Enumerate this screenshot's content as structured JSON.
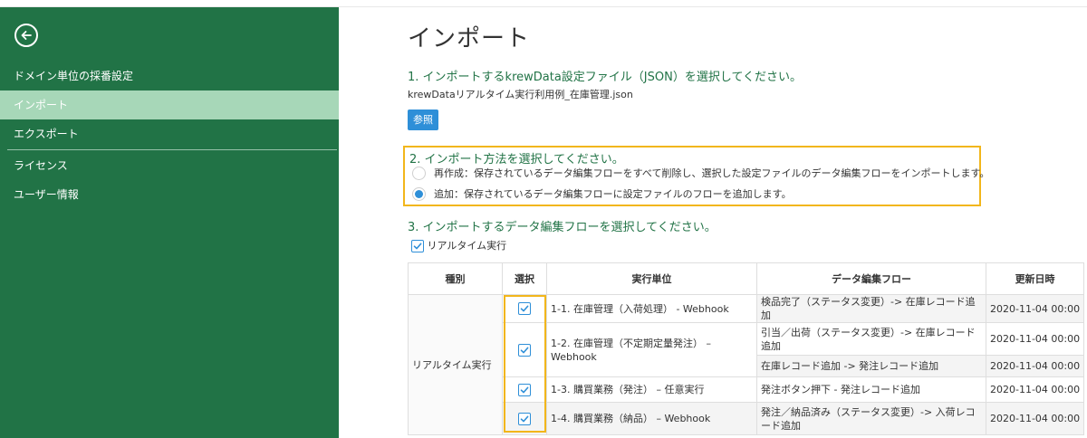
{
  "sidebar": {
    "items": [
      {
        "label": "ドメイン単位の採番設定"
      },
      {
        "label": "インポート"
      },
      {
        "label": "エクスポート"
      },
      {
        "label": "ライセンス"
      },
      {
        "label": "ユーザー情報"
      }
    ]
  },
  "main": {
    "title": "インポート",
    "step1": {
      "title": "1. インポートするkrewData設定ファイル（JSON）を選択してください。",
      "filename": "krewDataリアルタイム実行利用例_在庫管理.json",
      "browse_label": "参照"
    },
    "step2": {
      "title": "2. インポート方法を選択してください。",
      "options": [
        {
          "label": "再作成：保存されているデータ編集フローをすべて削除し、選択した設定ファイルのデータ編集フローをインポートします。",
          "checked": false
        },
        {
          "label": "追加：保存されているデータ編集フローに設定ファイルのフローを追加します。",
          "checked": true
        }
      ]
    },
    "step3": {
      "title": "3. インポートするデータ編集フローを選択してください。",
      "realtime_label": "リアルタイム実行"
    },
    "table": {
      "headers": [
        "種別",
        "選択",
        "実行単位",
        "データ編集フロー",
        "更新日時"
      ],
      "type_label": "リアルタイム実行",
      "units": [
        {
          "name": "1-1. 在庫管理（入荷処理） - Webhook",
          "flows": [
            {
              "flow": "検品完了（ステータス変更）-> 在庫レコード追加",
              "date": "2020-11-04 00:00"
            }
          ]
        },
        {
          "name": "1-2. 在庫管理（不定期定量発注） – Webhook",
          "flows": [
            {
              "flow": "引当／出荷（ステータス変更）-> 在庫レコード追加",
              "date": "2020-11-04 00:00"
            },
            {
              "flow": "在庫レコード追加 -> 発注レコード追加",
              "date": "2020-11-04 00:00"
            }
          ]
        },
        {
          "name": "1-3. 購買業務（発注） – 任意実行",
          "flows": [
            {
              "flow": "発注ボタン押下 - 発注レコード追加",
              "date": "2020-11-04 00:00"
            }
          ]
        },
        {
          "name": "1-4.  購買業務（納品） – Webhook",
          "flows": [
            {
              "flow": "発注／納品済み（ステータス変更）-> 入荷レコード追加",
              "date": "2020-11-04 00:00"
            }
          ]
        }
      ]
    }
  },
  "colors": {
    "sidebar_bg": "#217346",
    "sidebar_active": "#a7d7b8",
    "accent_green": "#217346",
    "button_blue": "#2e8fd8",
    "highlight_yellow": "#f2b61b"
  },
  "icons": {
    "back": "arrow-left-circle-icon",
    "check": "checkmark-icon"
  }
}
